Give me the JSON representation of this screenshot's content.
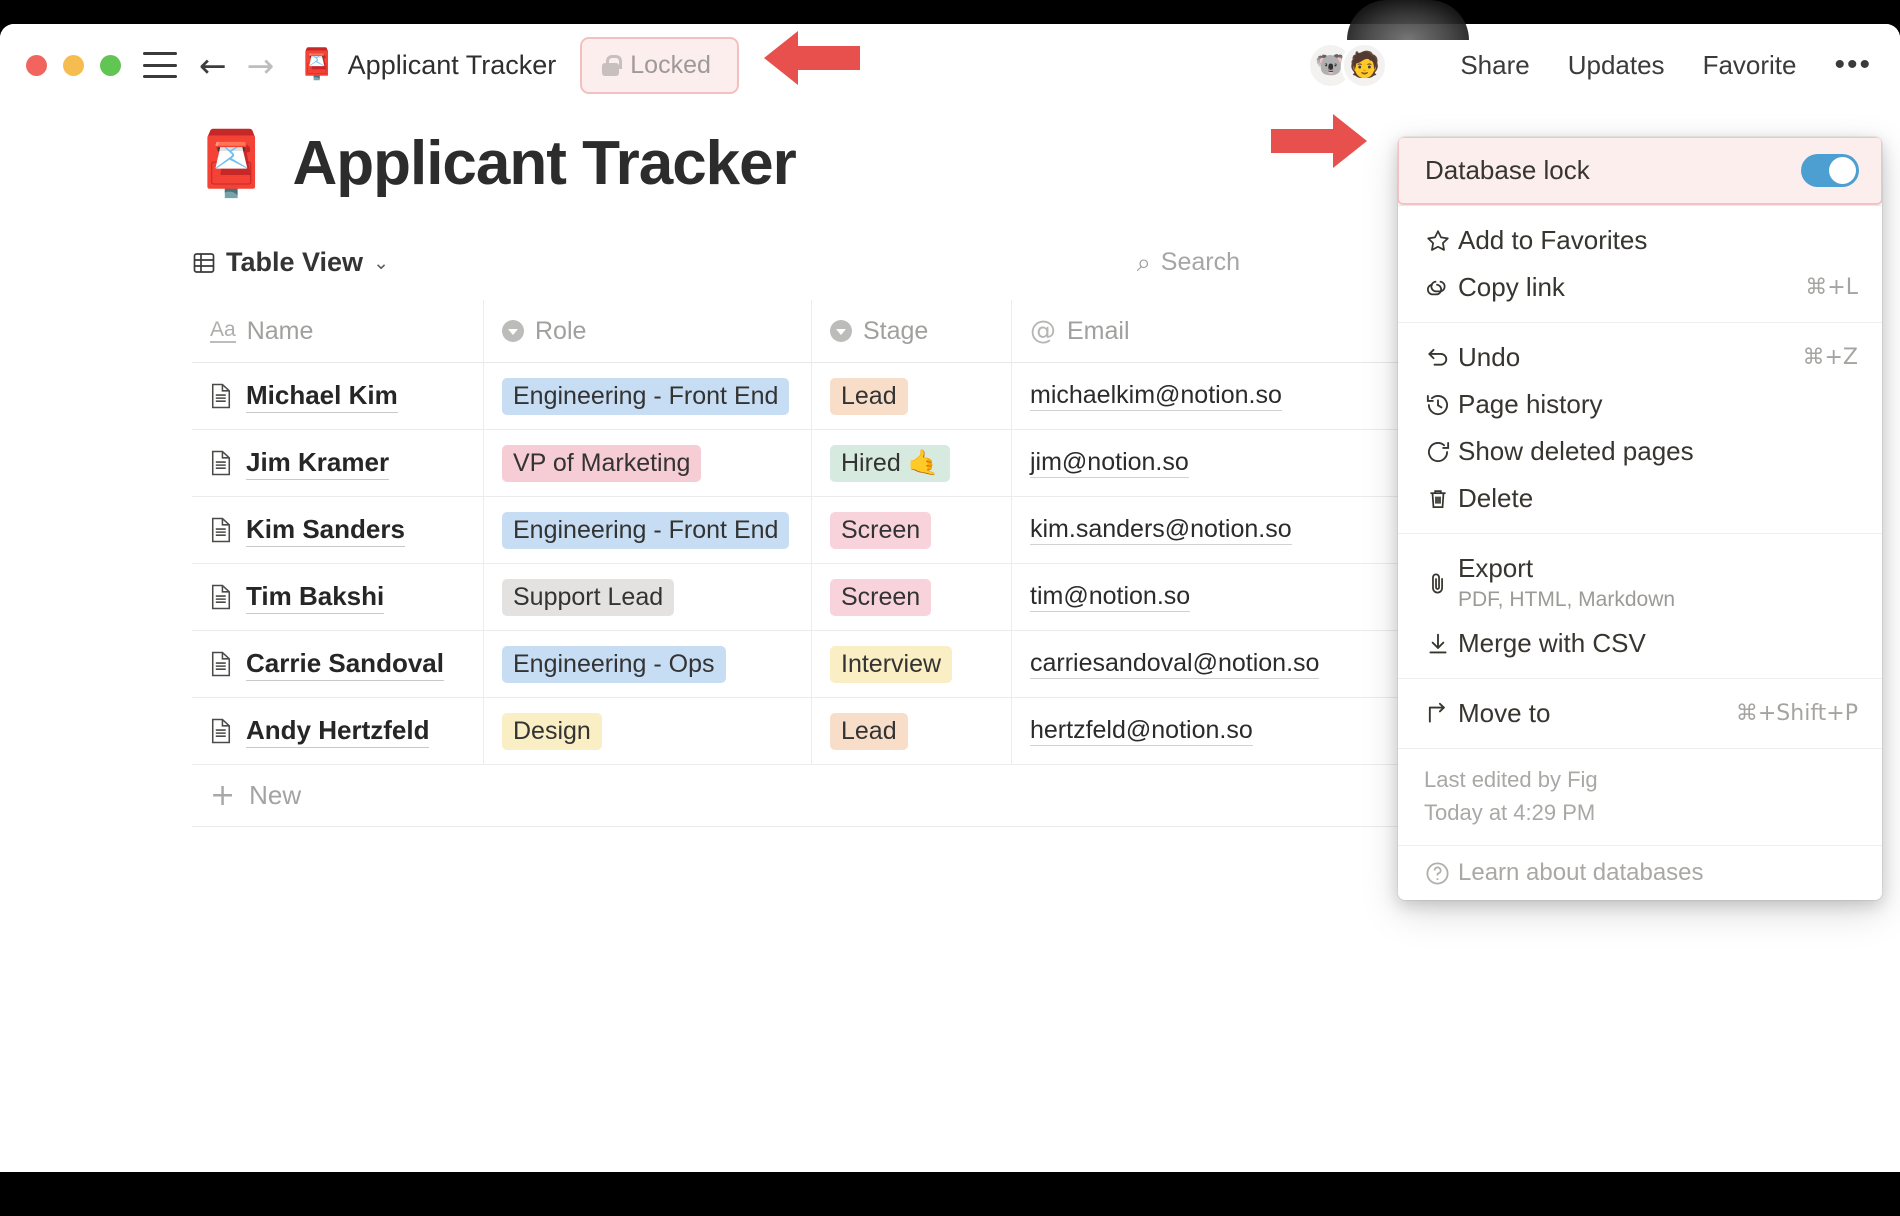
{
  "titlebar": {
    "window_title": "Applicant Tracker",
    "window_emoji": "📮",
    "locked_badge": "Locked",
    "menu_icon": "hamburger-icon",
    "back_icon": "←",
    "forward_icon": "→",
    "share_label": "Share",
    "updates_label": "Updates",
    "favorite_label": "Favorite",
    "more_label": "•••",
    "avatars": [
      "🐨",
      "🧑"
    ]
  },
  "page": {
    "emoji": "📮",
    "title": "Applicant Tracker"
  },
  "view": {
    "label": "Table View",
    "chevron": "⌄",
    "search_placeholder": "Search"
  },
  "table": {
    "columns": [
      {
        "label": "Name",
        "icon": "text-type-icon"
      },
      {
        "label": "Role",
        "icon": "select-type-icon"
      },
      {
        "label": "Stage",
        "icon": "select-type-icon"
      },
      {
        "label": "Email",
        "icon": "email-type-icon"
      }
    ],
    "rows": [
      {
        "name": "Michael Kim",
        "role": "Engineering - Front End",
        "role_color": "#c7ddf3",
        "stage": "Lead",
        "stage_color": "#f8ddc9",
        "email": "michaelkim@notion.so"
      },
      {
        "name": "Jim Kramer",
        "role": "VP of Marketing",
        "role_color": "#f6cdd4",
        "stage": "Hired 🤙",
        "stage_color": "#d7eadf",
        "email": "jim@notion.so"
      },
      {
        "name": "Kim Sanders",
        "role": "Engineering - Front End",
        "role_color": "#c7ddf3",
        "stage": "Screen",
        "stage_color": "#f8d3dc",
        "email": "kim.sanders@notion.so"
      },
      {
        "name": "Tim Bakshi",
        "role": "Support Lead",
        "role_color": "#e3e2e0",
        "stage": "Screen",
        "stage_color": "#f8d3dc",
        "email": "tim@notion.so"
      },
      {
        "name": "Carrie Sandoval",
        "role": "Engineering - Ops",
        "role_color": "#c7ddf3",
        "stage": "Interview",
        "stage_color": "#faeec4",
        "email": "carriesandoval@notion.so"
      },
      {
        "name": "Andy Hertzfeld",
        "role": "Design",
        "role_color": "#faeec4",
        "stage": "Lead",
        "stage_color": "#f8ddc9",
        "email": "hertzfeld@notion.so"
      }
    ],
    "new_row_label": "New",
    "new_row_plus": "+"
  },
  "menu": {
    "database_lock": {
      "label": "Database lock",
      "enabled": true
    },
    "groups": [
      {
        "items": [
          {
            "label": "Add to Favorites",
            "icon": "star-icon",
            "shortcut": ""
          },
          {
            "label": "Copy link",
            "icon": "link-icon",
            "shortcut": "⌘+L"
          }
        ]
      },
      {
        "items": [
          {
            "label": "Undo",
            "icon": "undo-icon",
            "shortcut": "⌘+Z"
          },
          {
            "label": "Page history",
            "icon": "history-icon",
            "shortcut": ""
          },
          {
            "label": "Show deleted pages",
            "icon": "restore-icon",
            "shortcut": ""
          },
          {
            "label": "Delete",
            "icon": "trash-icon",
            "shortcut": ""
          }
        ]
      },
      {
        "items": [
          {
            "label": "Export",
            "icon": "paperclip-icon",
            "sublabel": "PDF, HTML, Markdown",
            "shortcut": ""
          },
          {
            "label": "Merge with CSV",
            "icon": "download-icon",
            "shortcut": ""
          }
        ]
      },
      {
        "items": [
          {
            "label": "Move to",
            "icon": "move-to-icon",
            "shortcut": "⌘+Shift+P"
          }
        ]
      }
    ],
    "meta": {
      "last_edited_by": "Last edited by Fig",
      "last_edited_at": "Today at 4:29 PM"
    },
    "footer": {
      "label": "Learn about databases",
      "icon": "question-circle-icon"
    }
  },
  "annotations": {
    "arrow_to_locked": "left-pointing-red-arrow",
    "arrow_to_database_lock": "right-pointing-red-arrow"
  }
}
